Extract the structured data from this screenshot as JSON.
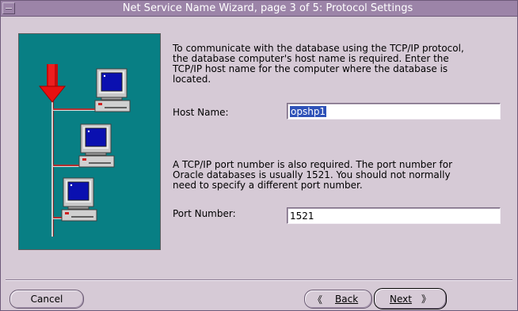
{
  "window": {
    "title": "Net Service Name Wizard, page 3 of 5: Protocol Settings"
  },
  "main": {
    "intro_text_lines": [
      "To communicate with the database using the TCP/IP protocol,",
      "the database computer's host name is required.  Enter the",
      "TCP/IP host name for the computer where the database is",
      "located."
    ],
    "host_name": {
      "label": "Host Name:",
      "value": "opshp1"
    },
    "port_text_lines": [
      "A TCP/IP port number is also required.  The port number for",
      "Oracle databases is usually 1521.  You should not normally",
      "need to specify a different port number."
    ],
    "port_number": {
      "label": "Port Number:",
      "value": "1521"
    }
  },
  "footer": {
    "cancel_label": "Cancel",
    "back_label": "Back",
    "back_icon": "chevron-left-icon",
    "next_label": "Next",
    "next_icon": "chevron-right-icon"
  },
  "colors": {
    "titlebar": "#9c84a8",
    "window_bg": "#d6cad6",
    "illustration_bg": "#087f84",
    "arrow": "#e81010",
    "selection": "#2f52b8"
  }
}
